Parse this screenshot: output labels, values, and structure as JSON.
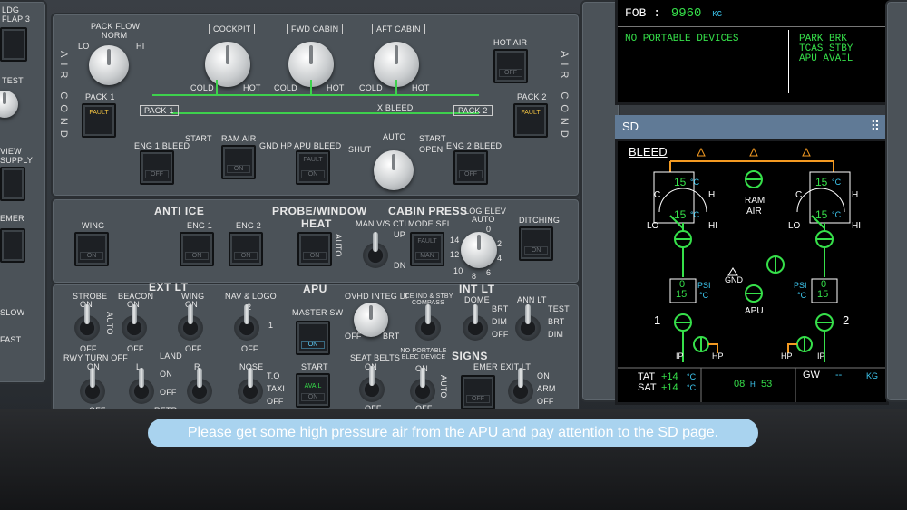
{
  "air_cond": {
    "side_label_left": "AIR COND",
    "side_label_right": "AIR COND",
    "pack_flow": {
      "label": "PACK FLOW",
      "norm": "NORM",
      "lo": "LO",
      "hi": "HI"
    },
    "temp_knobs": [
      {
        "label": "COCKPIT",
        "cold": "COLD",
        "hot": "HOT"
      },
      {
        "label": "FWD CABIN",
        "cold": "COLD",
        "hot": "HOT"
      },
      {
        "label": "AFT CABIN",
        "cold": "COLD",
        "hot": "HOT"
      }
    ],
    "hot_air": {
      "label": "HOT AIR",
      "state": "OFF"
    },
    "pack1": {
      "label": "PACK 1",
      "fault": "FAULT",
      "duct_label": "PACK 1"
    },
    "pack2": {
      "label": "PACK 2",
      "fault": "FAULT",
      "duct_label": "PACK 2"
    },
    "xbleed": {
      "label": "X BLEED",
      "shut": "SHUT",
      "auto": "AUTO",
      "open": "OPEN"
    },
    "start_left": "START",
    "start_right": "START",
    "ram_air": {
      "label": "RAM AIR",
      "state": "ON"
    },
    "gnd_hp": "GND HP",
    "eng1_bleed": {
      "label": "ENG 1 BLEED",
      "state": "OFF"
    },
    "apu_bleed": {
      "label": "APU BLEED",
      "fault": "FAULT",
      "state": "ON"
    },
    "eng2_bleed": {
      "label": "ENG 2 BLEED",
      "state": "OFF"
    }
  },
  "anti_ice": {
    "title": "ANTI ICE",
    "wing": {
      "label": "WING",
      "state": "ON"
    },
    "eng1": {
      "label": "ENG 1",
      "state": "ON"
    },
    "eng2": {
      "label": "ENG 2",
      "state": "ON"
    }
  },
  "probe": {
    "title_line1": "PROBE/WINDOW",
    "title_line2": "HEAT",
    "state": "ON",
    "auto": "AUTO"
  },
  "cabin_press": {
    "title": "CABIN PRESS",
    "man_vs": "MAN V/S CTL",
    "up": "UP",
    "dn": "DN",
    "mode_sel": "MODE SEL",
    "mode_state": "MAN",
    "mode_fault": "FAULT",
    "log_elev": "LOG ELEV",
    "log_auto": "AUTO",
    "ditching": {
      "label": "DITCHING",
      "state": "ON"
    },
    "dial_ticks": [
      "0",
      "2",
      "4",
      "6",
      "8",
      "10",
      "12",
      "14"
    ]
  },
  "ext_lt": {
    "title": "EXT LT",
    "strobe": {
      "label": "STROBE",
      "on": "ON",
      "auto": "AUTO",
      "off": "OFF"
    },
    "beacon": {
      "label": "BEACON",
      "on": "ON",
      "off": "OFF"
    },
    "wing": {
      "label": "WING",
      "on": "ON",
      "off": "OFF"
    },
    "nav_logo": {
      "label": "NAV & LOGO",
      "pos2": "2",
      "pos1": "1",
      "off": "OFF"
    },
    "rwy_turn_off": {
      "label": "RWY TURN OFF",
      "on": "ON",
      "off": "OFF"
    },
    "land": {
      "label": "LAND",
      "l": "L",
      "r": "R",
      "on": "ON",
      "off": "OFF",
      "retr": "RETR"
    },
    "nose": {
      "label": "NOSE",
      "to": "T.O",
      "taxi": "TAXI",
      "off": "OFF"
    }
  },
  "apu": {
    "title": "APU",
    "master": {
      "label": "MASTER SW",
      "state": "ON"
    },
    "start": {
      "label": "START",
      "avail": "AVAIL",
      "state": "ON"
    }
  },
  "int_lt": {
    "ovhd_integ": {
      "label": "OVHD INTEG LT",
      "off": "OFF",
      "brt": "BRT"
    },
    "ice_ind": {
      "label": "ICE IND & STBY COMPASS"
    },
    "title": "INT LT",
    "dome": {
      "label": "DOME",
      "brt": "BRT",
      "dim": "DIM",
      "off": "OFF"
    },
    "ann_lt": {
      "label": "ANN LT",
      "test": "TEST",
      "brt": "BRT",
      "dim": "DIM"
    }
  },
  "signs": {
    "title": "SIGNS",
    "seat_belts": {
      "label": "SEAT BELTS",
      "on": "ON",
      "off": "OFF"
    },
    "no_portable": {
      "label": "NO PORTABLE ELEC DEVICE",
      "on": "ON",
      "off": "OFF",
      "auto": "AUTO"
    },
    "emer_exit": {
      "label": "EMER EXIT LT",
      "on": "ON",
      "arm": "ARM",
      "off": "OFF",
      "state": "OFF"
    }
  },
  "left_edge": {
    "ldg": "LDG",
    "flap3": "FLAP 3",
    "test": "TEST",
    "view": "VIEW",
    "supply": "SUPPLY",
    "emer": "EMER",
    "slow": "SLOW",
    "fast": "FAST"
  },
  "ewd": {
    "fob_label": "FOB :",
    "fob_value": "9960",
    "fob_unit": "KG",
    "memo_left": "NO PORTABLE DEVICES",
    "memo_right": [
      "PARK BRK",
      "TCAS STBY",
      "APU AVAIL"
    ]
  },
  "sd": {
    "header": "SD",
    "page_title": "BLEED",
    "left_temp_top": "15",
    "left_temp_bottom": "15",
    "temp_unit": "°C",
    "c": "C",
    "h": "H",
    "lo": "LO",
    "hi": "HI",
    "right_temp_top": "15",
    "right_temp_bottom": "15",
    "ram_air": [
      "RAM",
      "AIR"
    ],
    "gnd": "GND",
    "apu": "APU",
    "psi_left": {
      "val_top": "0",
      "val_bottom": "15",
      "psi": "PSI",
      "unit": "°C"
    },
    "psi_right": {
      "val_top": "0",
      "val_bottom": "15",
      "psi": "PSI",
      "unit": "°C"
    },
    "eng1": "1",
    "eng2": "2",
    "ip": "IP",
    "hp": "HP",
    "tat_label": "TAT",
    "tat_value": "+14",
    "sat_label": "SAT",
    "sat_value": "+14",
    "time_h": "08",
    "h_sep": "H",
    "time_m": "53",
    "gw_label": "GW",
    "gw_value": "--",
    "gw_unit": "KG"
  },
  "banner": {
    "text": "Please get some high pressure air from the APU and pay attention to the SD page."
  }
}
